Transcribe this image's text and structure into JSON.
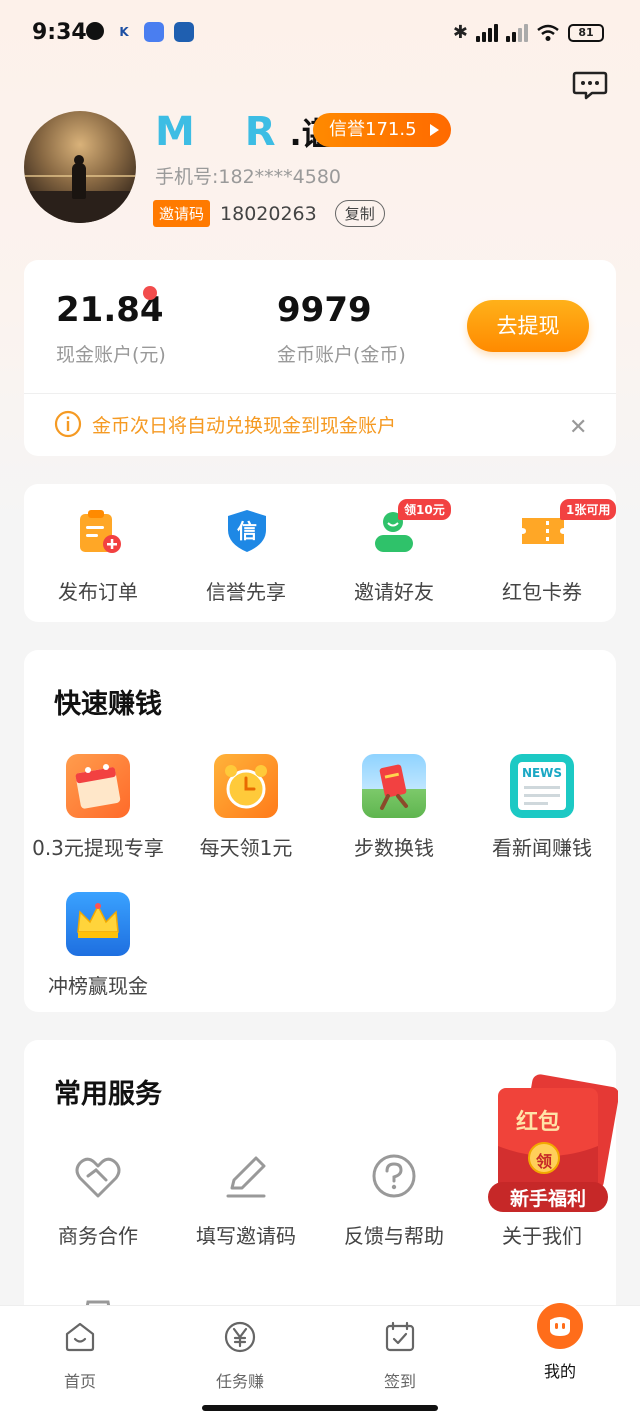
{
  "status_bar": {
    "time": "9:34",
    "battery": "81",
    "app_icon_k": "K"
  },
  "profile": {
    "name_prefix": "M R",
    "name_suffix": ".谌",
    "credit": "信誉171.5",
    "phone": "手机号:182****4580",
    "invite_tag": "邀请码",
    "invite_code": "18020263",
    "copy_label": "复制"
  },
  "account": {
    "cash_value": "21.84",
    "cash_label": "现金账户(元)",
    "coin_value": "9979",
    "coin_label": "金币账户(金币)",
    "withdraw_label": "去提现",
    "notice": "金币次日将自动兑换现金到现金账户"
  },
  "quick_actions": [
    {
      "label": "发布订单",
      "icon": "clipboard-plus-icon"
    },
    {
      "label": "信誉先享",
      "icon": "shield-credit-icon"
    },
    {
      "label": "邀请好友",
      "icon": "invite-person-icon",
      "badge": "领10元"
    },
    {
      "label": "红包卡券",
      "icon": "coupon-icon",
      "badge": "1张可用"
    }
  ],
  "earn": {
    "title": "快速赚钱",
    "items": [
      {
        "label": "0.3元提现专享",
        "icon": "calendar-icon"
      },
      {
        "label": "每天领1元",
        "icon": "alarm-clock-icon"
      },
      {
        "label": "步数换钱",
        "icon": "walking-envelope-icon"
      },
      {
        "label": "看新闻赚钱",
        "icon": "news-icon",
        "icon_text": "NEWS"
      },
      {
        "label": "冲榜赢现金",
        "icon": "crown-icon"
      }
    ]
  },
  "services": {
    "title": "常用服务",
    "items": [
      {
        "label": "商务合作",
        "icon": "handshake-heart-icon"
      },
      {
        "label": "填写邀请码",
        "icon": "pencil-icon"
      },
      {
        "label": "反馈与帮助",
        "icon": "question-icon"
      },
      {
        "label": "关于我们",
        "icon": "info-icon"
      }
    ]
  },
  "float_envelope": {
    "top": "红包",
    "center": "领",
    "banner": "新手福利"
  },
  "bottom_nav": [
    {
      "label": "首页",
      "icon": "home-smile-icon"
    },
    {
      "label": "任务赚",
      "icon": "yen-coin-icon"
    },
    {
      "label": "签到",
      "icon": "calendar-check-icon"
    },
    {
      "label": "我的",
      "icon": "profile-face-icon",
      "active": true
    }
  ],
  "colors": {
    "accent_orange": "#ff8a00",
    "name_blue": "#3dbde4",
    "notice_orange": "#f59a23",
    "badge_red": "#f24141"
  }
}
